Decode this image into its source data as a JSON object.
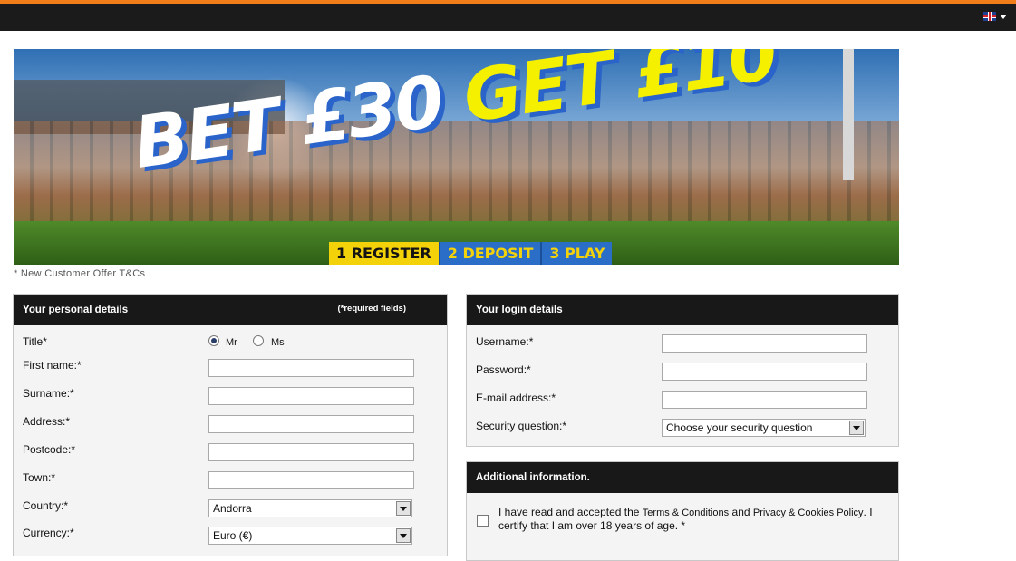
{
  "header": {
    "language_icon": "uk-flag-icon",
    "dropdown_icon": "caret-down-icon",
    "accent_color": "#f07d1a"
  },
  "banner": {
    "headline_part1": "BET £30",
    "headline_part2": "GET £10",
    "steps": [
      "1 REGISTER",
      "2 DEPOSIT",
      "3 PLAY"
    ]
  },
  "offer_note": "* New Customer Offer T&Cs",
  "personal": {
    "heading": "Your personal details",
    "required_note": "(*required fields)",
    "title_label": "Title*",
    "title_options": [
      "Mr",
      "Ms"
    ],
    "selected_title": "Mr",
    "labels": {
      "first_name": "First name:*",
      "surname": "Surname:*",
      "address": "Address:*",
      "postcode": "Postcode:*",
      "town": "Town:*",
      "country": "Country:*",
      "currency": "Currency:*"
    },
    "values": {
      "country": "Andorra",
      "currency": "Euro (€)"
    }
  },
  "login": {
    "heading": "Your login details",
    "labels": {
      "username": "Username:*",
      "password": "Password:*",
      "email": "E-mail address:*",
      "security": "Security question:*"
    },
    "security_value": "Choose your security question"
  },
  "additional": {
    "heading": "Additional information.",
    "terms_prefix": "I have read and accepted the",
    "terms_link": "Terms & Conditions",
    "terms_and": "and",
    "privacy_link": "Privacy & Cookies Policy",
    "terms_suffix": ". I certify that I am over 18 years of age. *"
  }
}
